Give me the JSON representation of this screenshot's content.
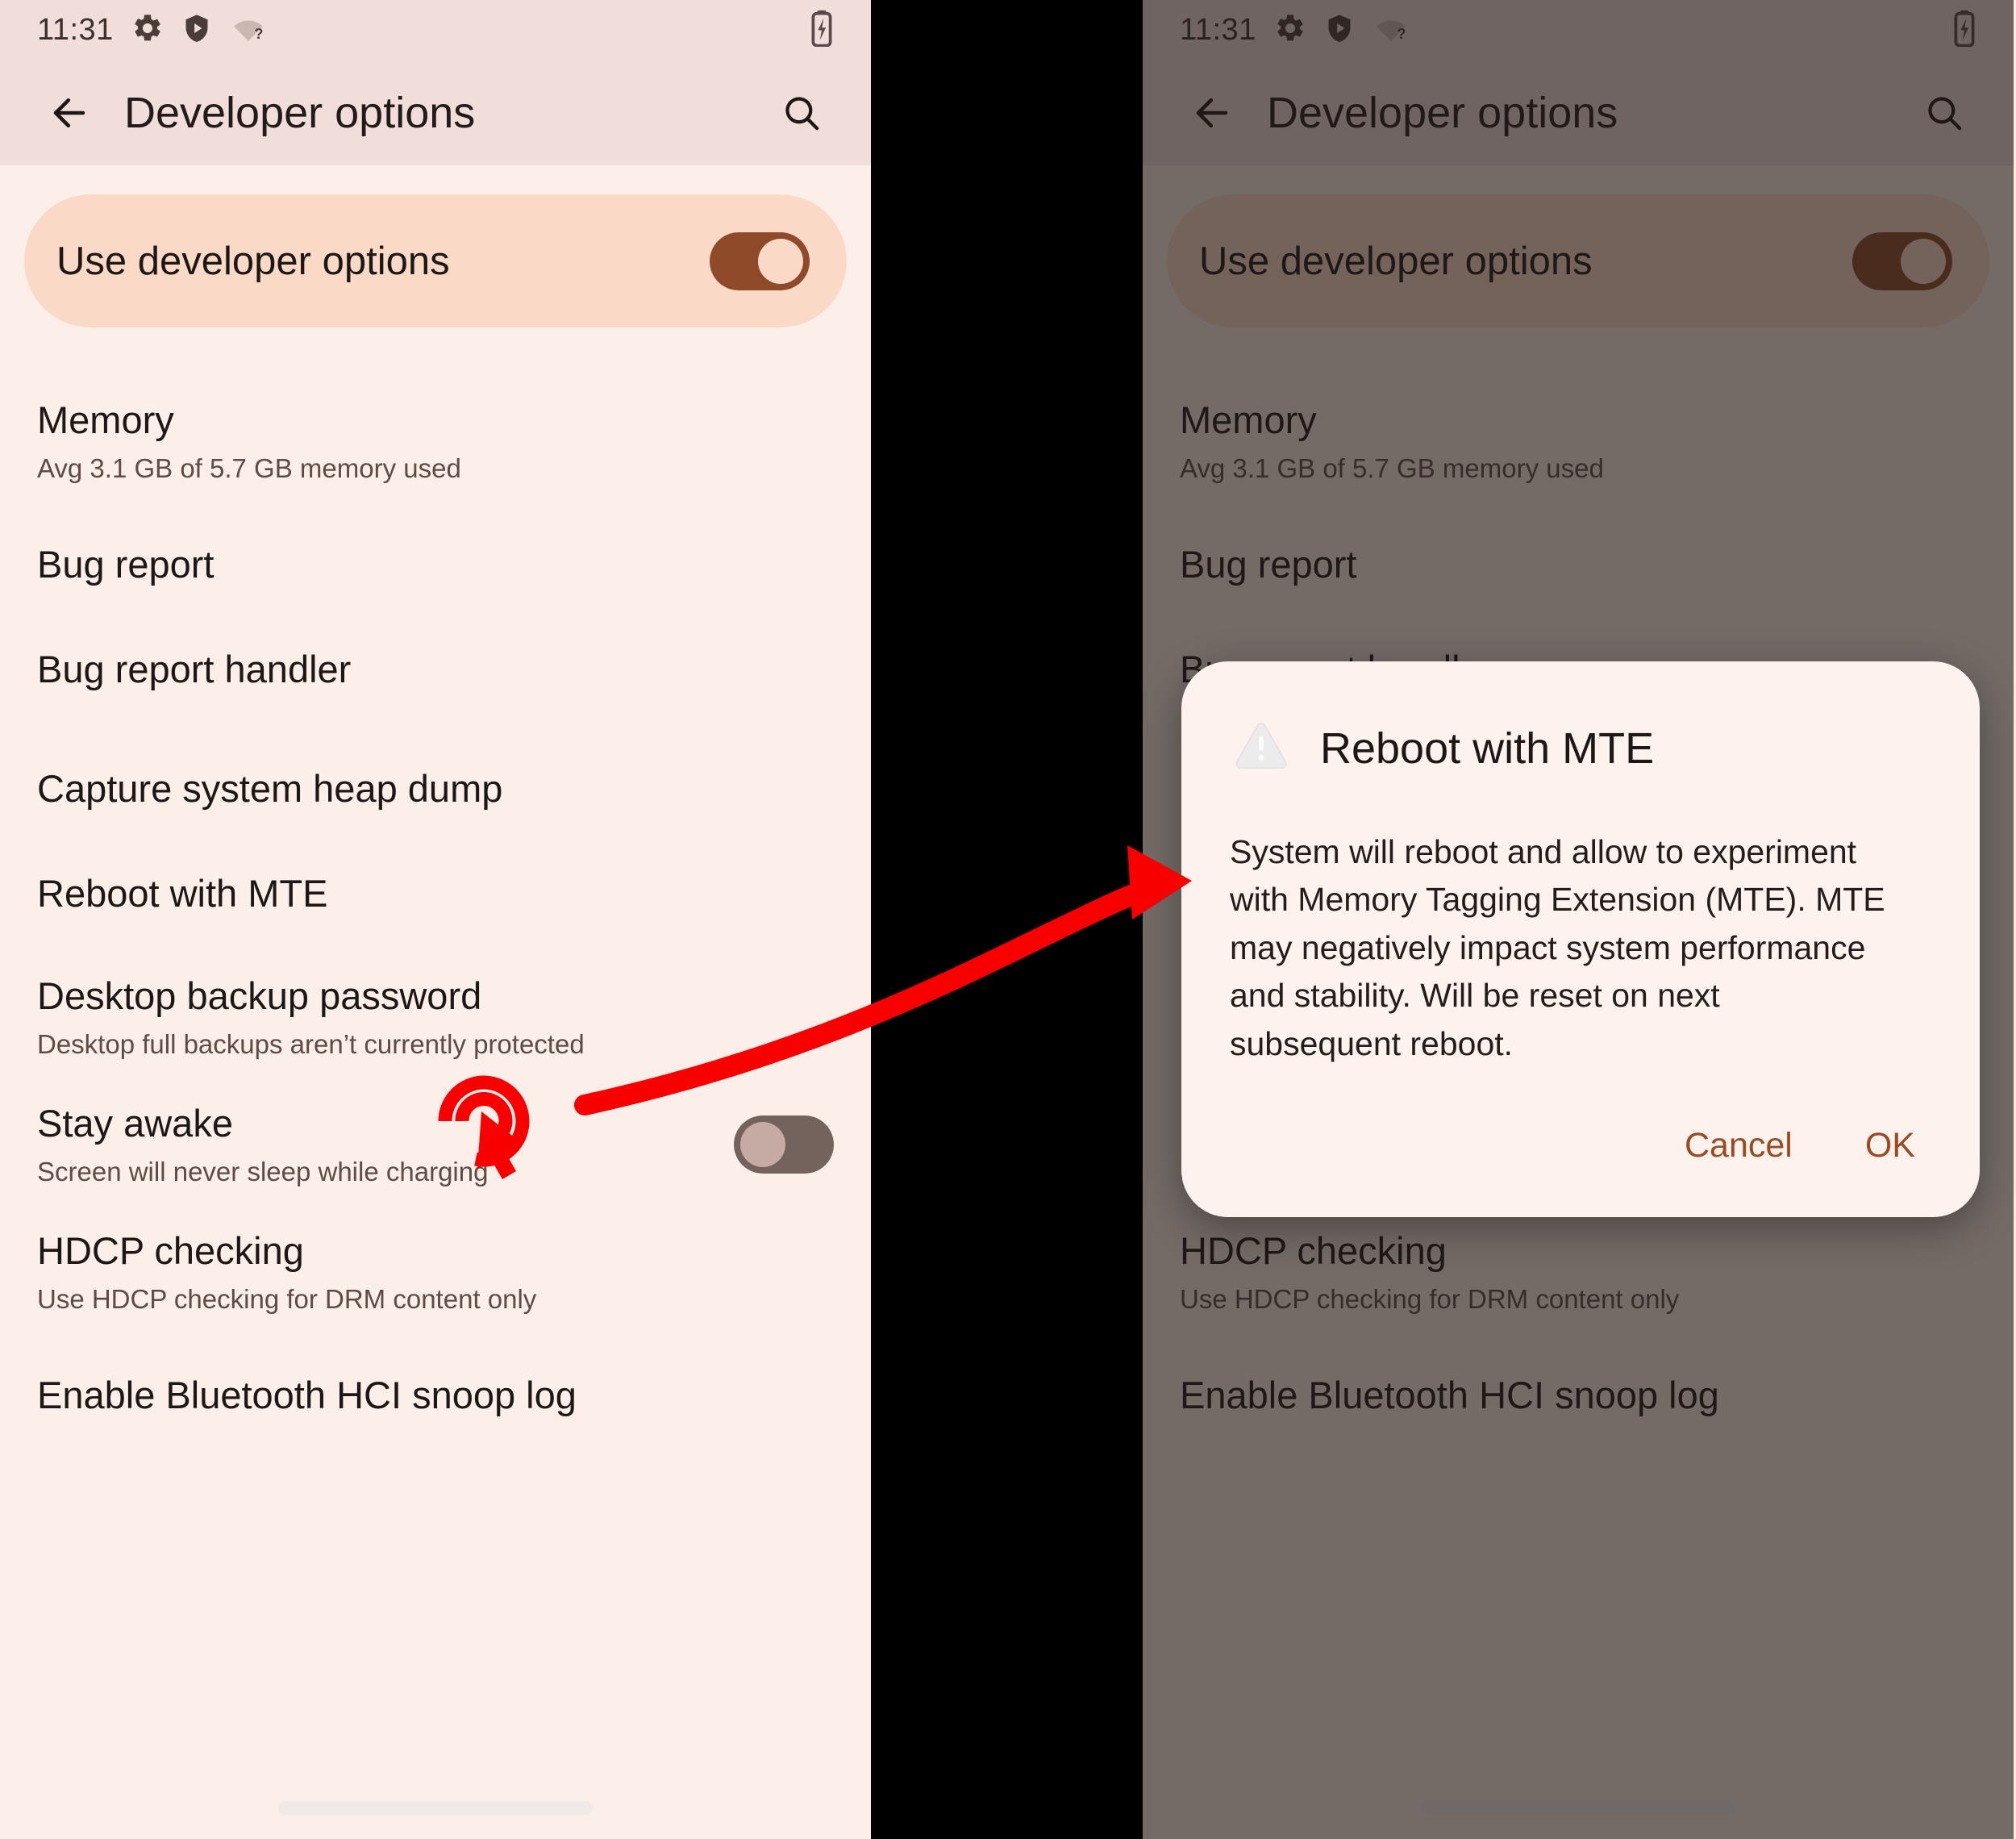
{
  "status_bar": {
    "time": "11:31",
    "icons": [
      "gear-icon",
      "shield-play-icon",
      "wifi-question-icon"
    ],
    "battery": "battery-charging-icon"
  },
  "app_bar": {
    "back_label": "back-arrow-icon",
    "title": "Developer options",
    "search_label": "search-icon"
  },
  "master_switch": {
    "label": "Use developer options",
    "state": "on"
  },
  "settings": [
    {
      "title": "Memory",
      "subtitle": "Avg 3.1 GB of 5.7 GB memory used",
      "toggle": null
    },
    {
      "title": "Bug report",
      "subtitle": "",
      "toggle": null
    },
    {
      "title": "Bug report handler",
      "subtitle": "",
      "toggle": null
    },
    {
      "title": "Capture system heap dump",
      "subtitle": "",
      "toggle": null
    },
    {
      "title": "Reboot with MTE",
      "subtitle": "",
      "toggle": null
    },
    {
      "title": "Desktop backup password",
      "subtitle": "Desktop full backups aren’t currently protected",
      "toggle": null
    },
    {
      "title": "Stay awake",
      "subtitle": "Screen will never sleep while charging",
      "toggle": "off"
    },
    {
      "title": "HDCP checking",
      "subtitle": "Use HDCP checking for DRM content only",
      "toggle": null
    },
    {
      "title": "Enable Bluetooth HCI snoop log",
      "subtitle": "",
      "toggle": null
    }
  ],
  "dialog": {
    "icon": "warning-triangle-icon",
    "title": "Reboot with MTE",
    "body": "System will reboot and allow to experiment with Memory Tagging Extension (MTE). MTE may negatively impact system performance and stability. Will be reset on next subsequent reboot.",
    "cancel_label": "Cancel",
    "ok_label": "OK"
  },
  "annotations": {
    "click_target": "Reboot with MTE",
    "arrow_color": "#f80000",
    "click_marker_color": "#f80000"
  },
  "colors": {
    "surface": "#fceee8",
    "appbar": "#f1dedb",
    "master_card": "#fbd9c7",
    "accent_on": "#8f4a2a",
    "switch_off": "#74635d",
    "dialog_surface": "#fdf2ee",
    "dialog_action": "#9b4a22",
    "gutter": "#000000",
    "scrim": "rgba(33,26,24,0.62)"
  }
}
